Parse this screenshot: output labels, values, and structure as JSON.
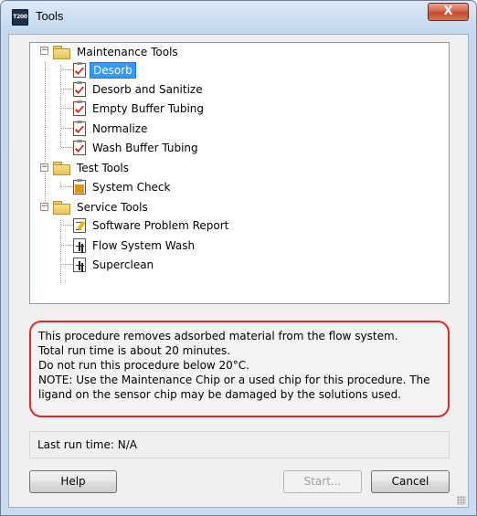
{
  "window": {
    "title": "Tools",
    "app_icon_text": "T200",
    "close_symbol": "X"
  },
  "tree": {
    "groups": [
      {
        "label": "Maintenance Tools",
        "expanded": true,
        "items": [
          {
            "label": "Desorb",
            "icon": "clipboard-check-icon",
            "selected": true
          },
          {
            "label": "Desorb and Sanitize",
            "icon": "clipboard-check-icon"
          },
          {
            "label": "Empty Buffer Tubing",
            "icon": "clipboard-check-icon"
          },
          {
            "label": "Normalize",
            "icon": "clipboard-check-icon"
          },
          {
            "label": "Wash Buffer Tubing",
            "icon": "clipboard-check-icon"
          }
        ]
      },
      {
        "label": "Test Tools",
        "expanded": true,
        "items": [
          {
            "label": "System Check",
            "icon": "system-check-icon"
          }
        ]
      },
      {
        "label": "Service Tools",
        "expanded": true,
        "items": [
          {
            "label": "Software Problem Report",
            "icon": "report-edit-icon"
          },
          {
            "label": "Flow System Wash",
            "icon": "flow-icon"
          },
          {
            "label": "Superclean",
            "icon": "flow-icon"
          }
        ]
      }
    ]
  },
  "description": {
    "lines": [
      "This procedure removes adsorbed material from the flow system.",
      "Total run time is about 20 minutes.",
      "Do not run this procedure below 20°C.",
      "NOTE: Use the Maintenance Chip or a used chip for this procedure. The",
      "ligand on the sensor chip may be damaged by the solutions used."
    ],
    "highlight_color": "#e02a2a"
  },
  "status": {
    "last_run_label": "Last run time:",
    "last_run_value": "N/A"
  },
  "buttons": {
    "help": "Help",
    "start": "Start...",
    "cancel": "Cancel"
  },
  "colors": {
    "selection": "#3399ff",
    "close_button": "#c24a2d"
  }
}
